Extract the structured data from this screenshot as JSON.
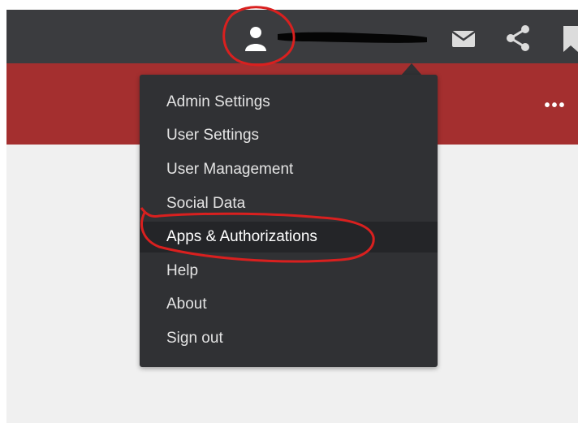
{
  "topbar": {
    "icons": {
      "user": "user-icon",
      "mail": "mail-icon",
      "share": "share-icon",
      "bookmark": "bookmark-icon"
    },
    "redacted_name": ""
  },
  "header": {
    "more_label": "•••"
  },
  "menu": {
    "items": [
      {
        "label": "Admin Settings"
      },
      {
        "label": "User Settings"
      },
      {
        "label": "User Management"
      },
      {
        "label": "Social Data"
      },
      {
        "label": "Apps & Authorizations",
        "highlighted": true
      },
      {
        "label": "Help"
      },
      {
        "label": "About"
      },
      {
        "label": "Sign out"
      }
    ]
  },
  "colors": {
    "topbar": "#3b3c3f",
    "accent_red": "#a42f2f",
    "menu_bg": "#303134",
    "annotation": "#d9201f"
  }
}
